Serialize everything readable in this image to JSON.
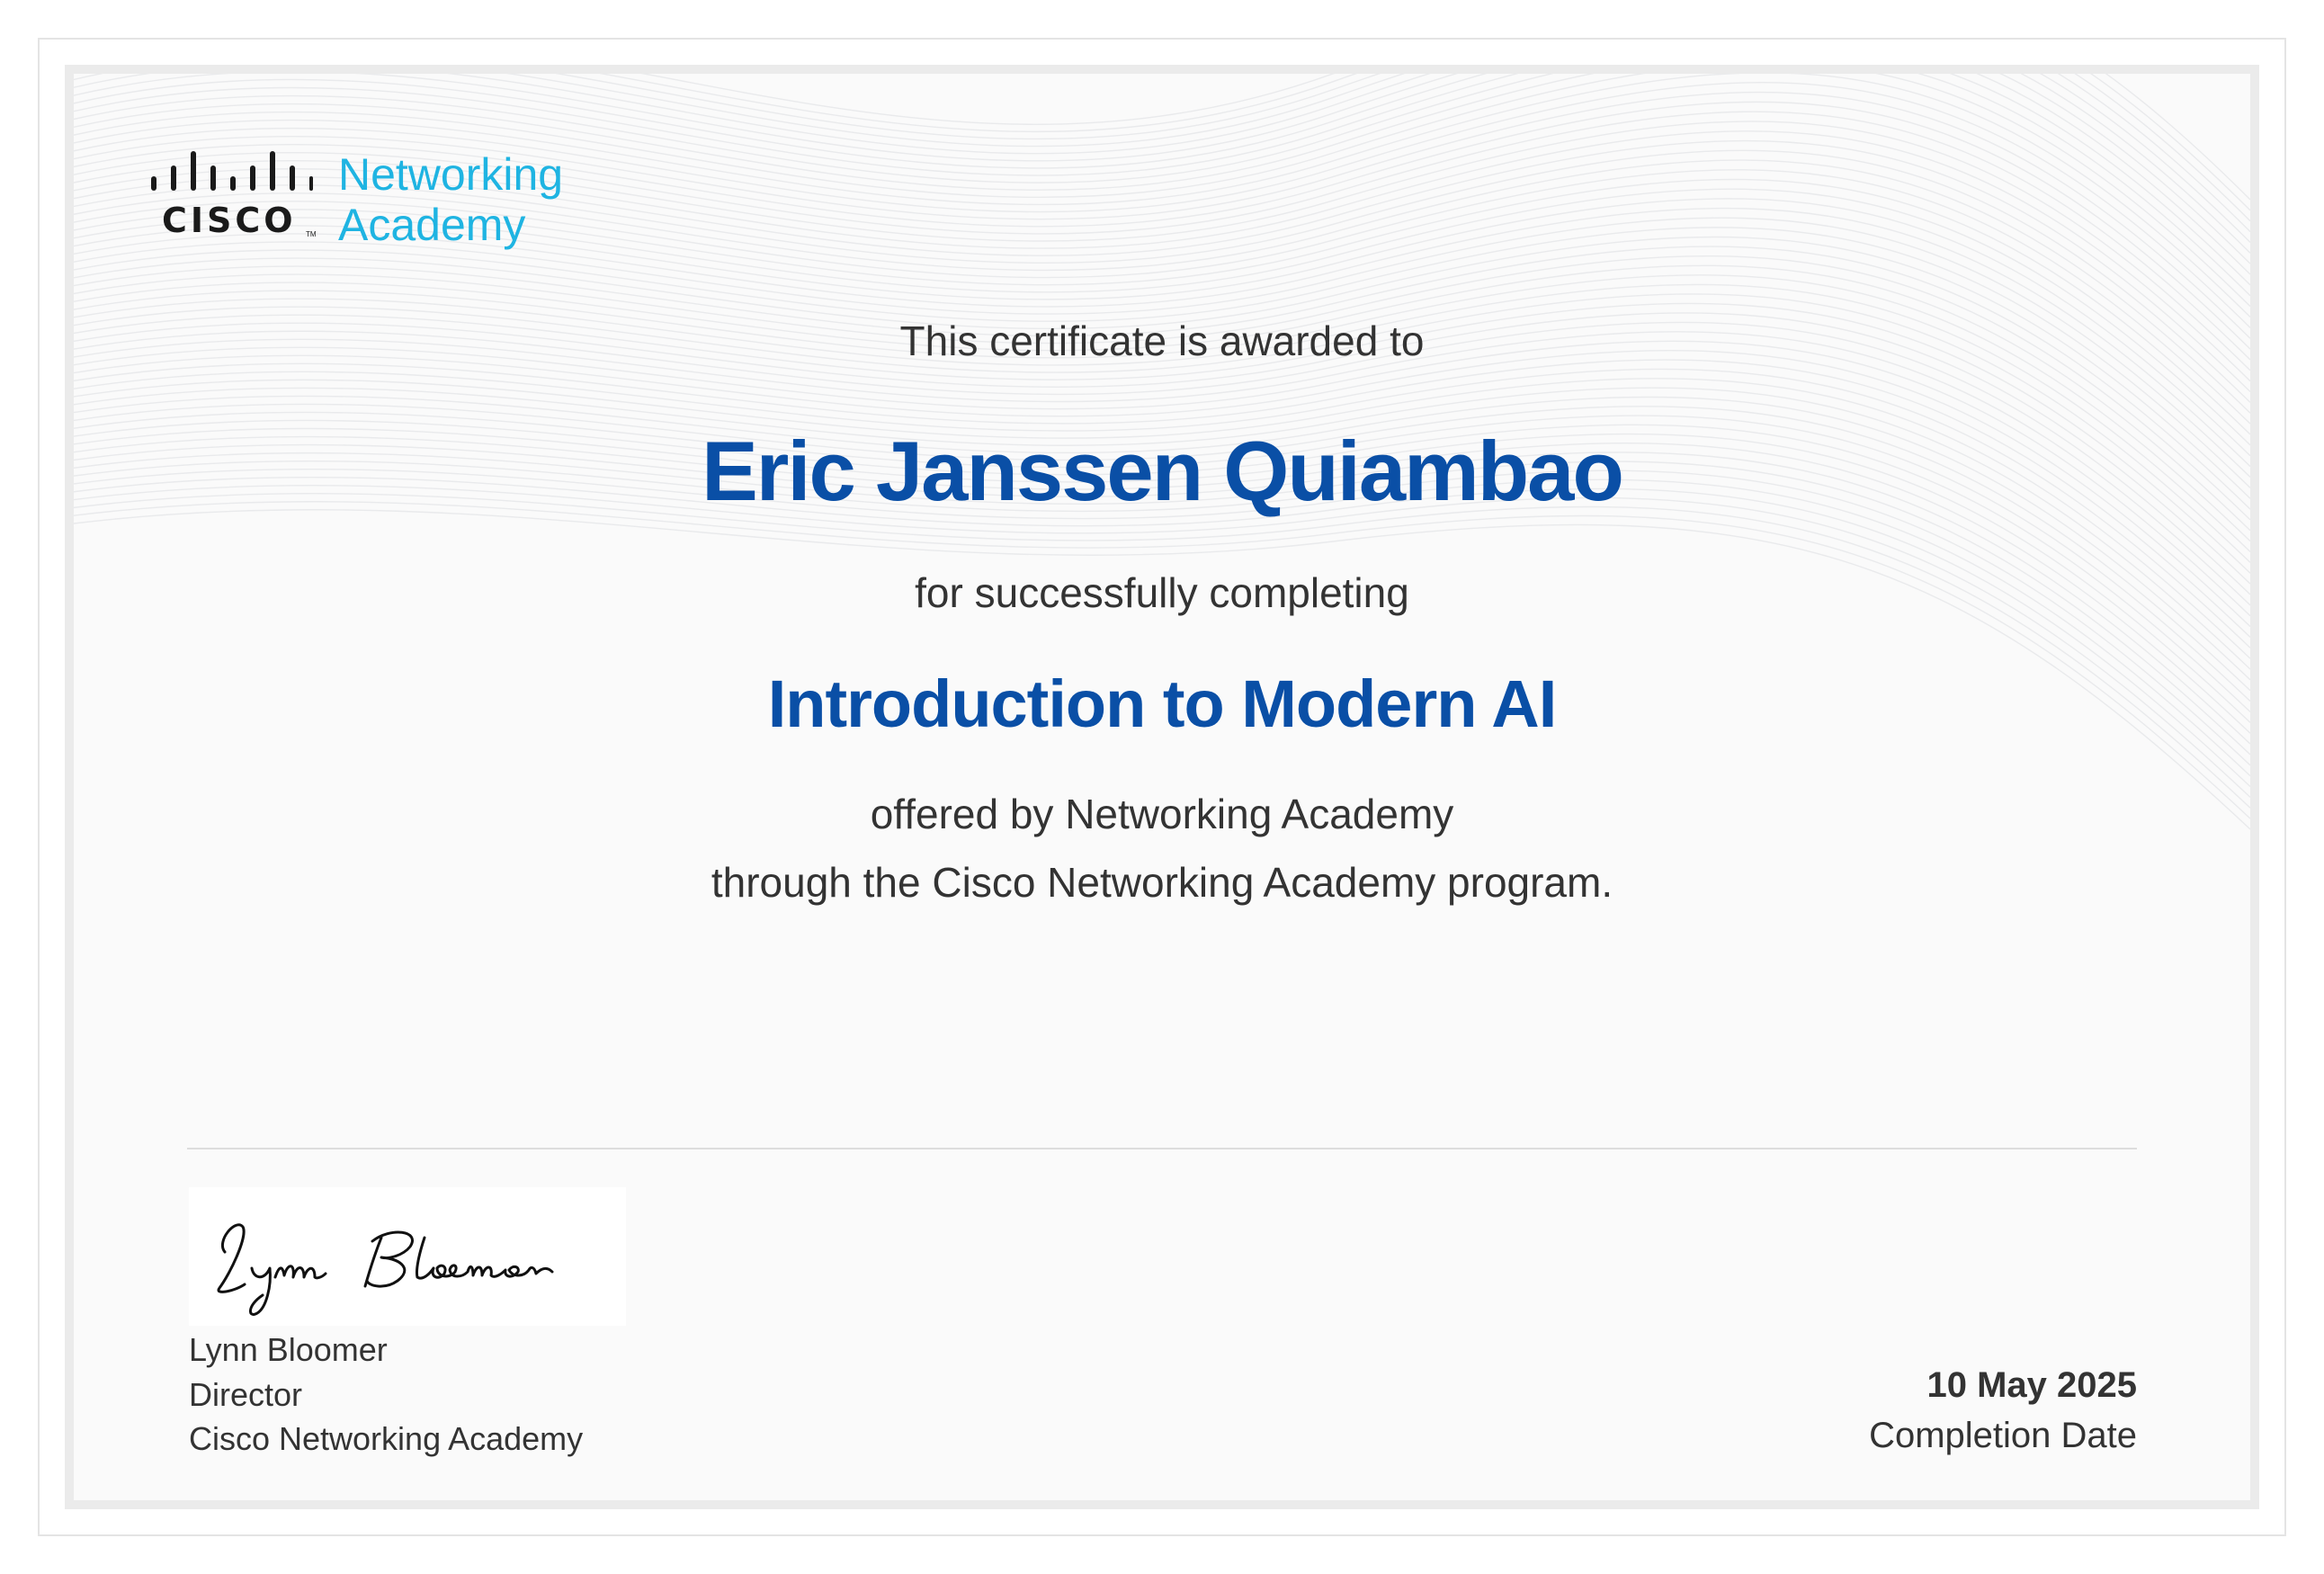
{
  "logo": {
    "wordmark": "CISCO",
    "tm": "TM",
    "product_line1": "Networking",
    "product_line2": "Academy",
    "brand_color": "#1fb4e2",
    "wordmark_color": "#1a1a1a"
  },
  "certificate": {
    "awarded_to": "This certificate is awarded to",
    "recipient_name": "Eric Janssen Quiambao",
    "for_completing": "for successfully completing",
    "course_name": "Introduction to Modern AI",
    "offered_by": "offered by Networking Academy",
    "program_line": "through the Cisco Networking Academy program.",
    "accent_color": "#0a4fa6"
  },
  "signatory": {
    "signature_image": "Lynn Bloomer",
    "name": "Lynn Bloomer",
    "title": "Director",
    "organization": "Cisco Networking Academy"
  },
  "completion": {
    "date": "10 May 2025",
    "label": "Completion Date"
  }
}
